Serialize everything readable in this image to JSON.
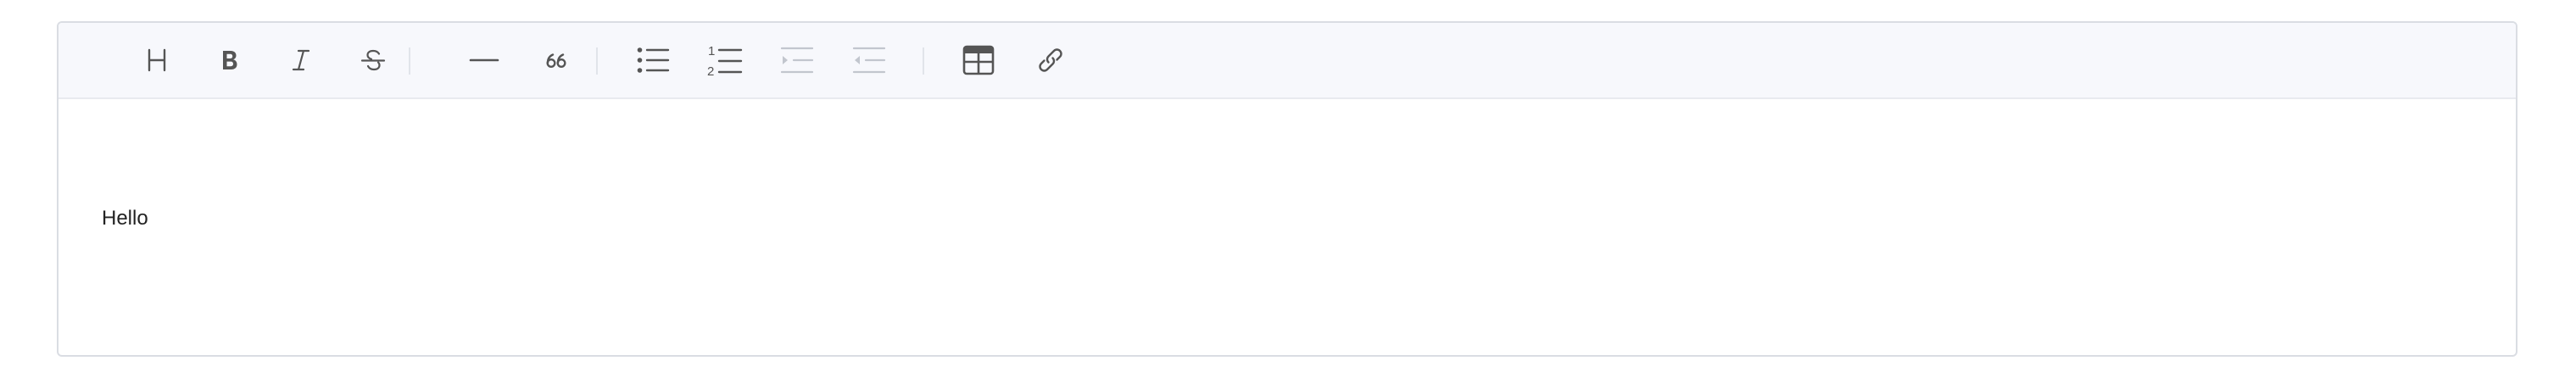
{
  "toolbar": {
    "items": [
      {
        "icon": "heading-icon",
        "enabled": true
      },
      {
        "icon": "bold-icon",
        "enabled": true
      },
      {
        "icon": "italic-icon",
        "enabled": true
      },
      {
        "icon": "strikethrough-icon",
        "enabled": true
      },
      {
        "icon": "horizontal-rule-icon",
        "enabled": true
      },
      {
        "icon": "blockquote-icon",
        "enabled": true
      },
      {
        "icon": "bullet-list-icon",
        "enabled": true
      },
      {
        "icon": "ordered-list-icon",
        "enabled": true
      },
      {
        "icon": "indent-icon",
        "enabled": false
      },
      {
        "icon": "outdent-icon",
        "enabled": false
      },
      {
        "icon": "table-icon",
        "enabled": true
      },
      {
        "icon": "link-icon",
        "enabled": true
      }
    ]
  },
  "content": {
    "text": "Hello"
  },
  "colors": {
    "icon": "#555555",
    "icon_disabled": "#c2c6ce",
    "toolbar_bg": "#f7f8fc",
    "border": "#dadde3"
  }
}
